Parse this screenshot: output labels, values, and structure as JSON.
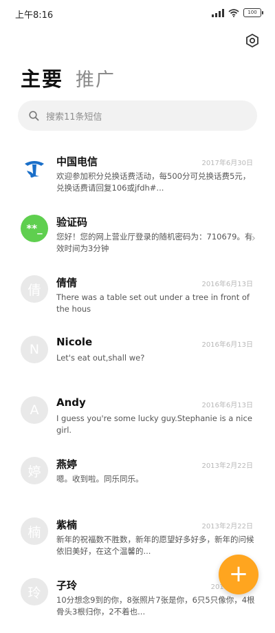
{
  "status": {
    "time": "上午8:16",
    "battery": "100"
  },
  "tabs": {
    "main": "主要",
    "recommended": "推广"
  },
  "search": {
    "placeholder": "搜索11条短信"
  },
  "conversations": [
    {
      "avatar": "",
      "name": "中国电信",
      "date": "2017年6月30日",
      "message": "欢迎参加积分兑换话费活动，每500分可兑换话费5元，兑换话费请回复106或jfdh#..."
    },
    {
      "avatar": "**_",
      "name": "验证码",
      "date": "",
      "message": "您好！您的网上营业厅登录的随机密码为：710679。有效时间为3分钟"
    },
    {
      "avatar": "倩",
      "name": "倩倩",
      "date": "2016年6月13日",
      "message": "There was a table set out under a tree in front of the hous"
    },
    {
      "avatar": "N",
      "name": "Nicole",
      "date": "2016年6月13日",
      "message": "Let's eat out,shall we?"
    },
    {
      "avatar": "A",
      "name": "Andy",
      "date": "2016年6月13日",
      "message": "I guess you're some lucky guy.Stephanie is a nice girl."
    },
    {
      "avatar": "婷",
      "name": "燕婷",
      "date": "2013年2月22日",
      "message": "嗯。收到啦。同乐同乐。"
    },
    {
      "avatar": "楠",
      "name": "紫楠",
      "date": "2013年2月22日",
      "message": "新年的祝福数不胜数，新年的愿望好多好多，新年的问候依旧美好，在这个温馨的..."
    },
    {
      "avatar": "玲",
      "name": "子玲",
      "date": "2013年2月...",
      "message": "10分想念9到的你，8张照片7张是你，6只5只像你，4根骨头3根归你，2不着也..."
    }
  ],
  "fab": {
    "label": "+"
  },
  "colors": {
    "accent": "#ffa51f",
    "green_avatar": "#5fcf4f",
    "telecom_blue": "#1a6fc9"
  }
}
